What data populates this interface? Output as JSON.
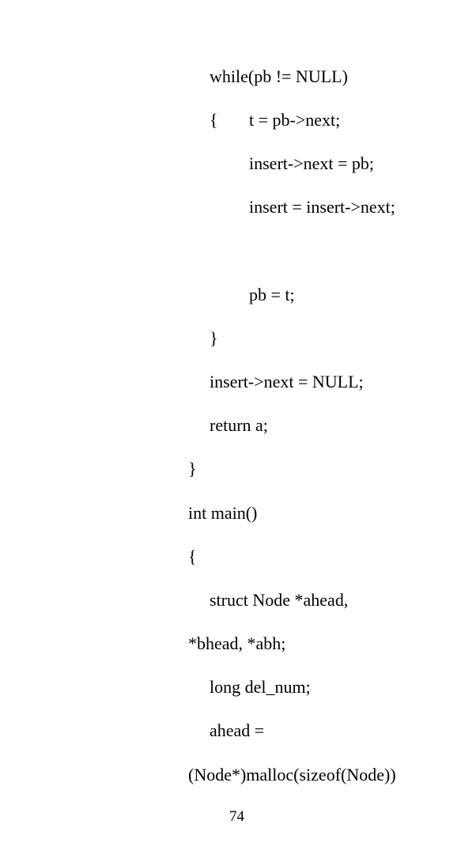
{
  "document": {
    "lines": [
      "while(pb != NULL)",
      "{",
      "t = pb->next;",
      "insert->next = pb;",
      "insert = insert->next;",
      "pb = t;",
      "}",
      "insert->next = NULL;",
      "return a;",
      "}",
      "int main()",
      "{",
      "struct Node *ahead,",
      "*bhead, *abh;",
      "long del_num;",
      "ahead =",
      "(Node*)malloc(sizeof(Node))"
    ],
    "page_number": "74"
  }
}
